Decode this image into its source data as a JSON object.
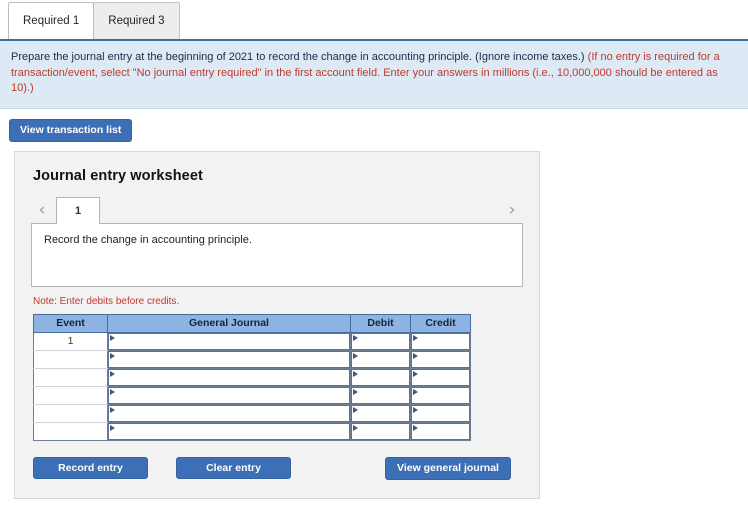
{
  "tabs": [
    {
      "label": "Required 1",
      "active": true
    },
    {
      "label": "Required 3",
      "active": false
    }
  ],
  "instructions": {
    "main_text": "Prepare the journal entry at the beginning of 2021 to record the change in accounting principle. (Ignore income taxes.)",
    "red_text": "(If no entry is required for a transaction/event, select \"No journal entry required\" in the first account field. Enter your answers in millions (i.e., 10,000,000 should be entered as 10).)"
  },
  "toolbar": {
    "view_transaction_list_label": "View transaction list"
  },
  "worksheet": {
    "title": "Journal entry worksheet",
    "pager": {
      "prev_icon": "chevron-left-icon",
      "next_icon": "chevron-right-icon",
      "current_page": "1"
    },
    "description": "Record the change in accounting principle.",
    "note": "Note: Enter debits before credits.",
    "table": {
      "headers": [
        "Event",
        "General Journal",
        "Debit",
        "Credit"
      ],
      "rows": [
        {
          "event": "1",
          "general_journal": "",
          "debit": "",
          "credit": ""
        },
        {
          "event": "",
          "general_journal": "",
          "debit": "",
          "credit": ""
        },
        {
          "event": "",
          "general_journal": "",
          "debit": "",
          "credit": ""
        },
        {
          "event": "",
          "general_journal": "",
          "debit": "",
          "credit": ""
        },
        {
          "event": "",
          "general_journal": "",
          "debit": "",
          "credit": ""
        },
        {
          "event": "",
          "general_journal": "",
          "debit": "",
          "credit": ""
        }
      ]
    },
    "footer_buttons": {
      "record_entry": "Record entry",
      "clear_entry": "Clear entry",
      "view_general_journal": "View general journal"
    }
  },
  "colors": {
    "accent_blue": "#3d6fb6",
    "panel_blue": "#ddeaf6",
    "header_blue": "#8db3e2",
    "note_red": "#c0392b"
  }
}
